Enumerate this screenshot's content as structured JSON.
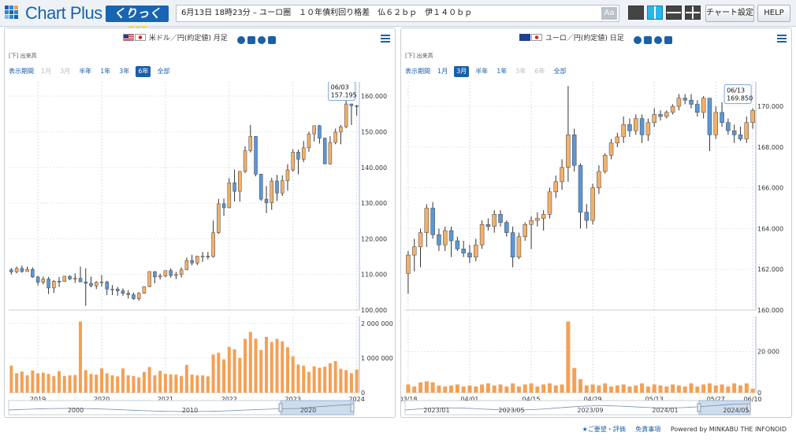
{
  "header": {
    "logo_text": "Chart Plus",
    "logo_badge_prefix": "くりっく",
    "logo_badge_number": "365",
    "ticker_text": "6月13日 18時23分 – ユーロ圏　１０年債利回り格差　仏６２ｂｐ　伊１４０ｂｐ",
    "font_button": "Aa",
    "chart_settings_label": "チャート設定",
    "help_label": "HELP",
    "layout_buttons": [
      "layout-1",
      "layout-2",
      "layout-3",
      "layout-4"
    ]
  },
  "colors": {
    "up": "#f2b06b",
    "down": "#5b97d6",
    "volume": "#f4a055",
    "accent": "#1a5fa8"
  },
  "panels": [
    {
      "title": "米ドル／円(約定値) 月足",
      "flags": [
        "us",
        "jp"
      ],
      "unit_label": "[下] 出来高",
      "period_label": "表示期間",
      "periods": [
        {
          "label": "1月",
          "state": "disabled"
        },
        {
          "label": "3月",
          "state": "disabled"
        },
        {
          "label": "半年",
          "state": "normal"
        },
        {
          "label": "1年",
          "state": "normal"
        },
        {
          "label": "3年",
          "state": "normal"
        },
        {
          "label": "6年",
          "state": "selected"
        },
        {
          "label": "全部",
          "state": "normal"
        }
      ],
      "tooltip_date": "06/03",
      "tooltip_value": "157.195",
      "navigator_labels": [
        "2000",
        "2010",
        "2020"
      ]
    },
    {
      "title": "ユーロ／円(約定値) 日足",
      "flags": [
        "eu",
        "jp"
      ],
      "unit_label": "[下] 出来高",
      "period_label": "表示期間",
      "periods": [
        {
          "label": "1月",
          "state": "normal"
        },
        {
          "label": "3月",
          "state": "selected"
        },
        {
          "label": "半年",
          "state": "normal"
        },
        {
          "label": "1年",
          "state": "normal"
        },
        {
          "label": "3年",
          "state": "disabled"
        },
        {
          "label": "6年",
          "state": "disabled"
        },
        {
          "label": "全部",
          "state": "normal"
        }
      ],
      "tooltip_date": "06/13",
      "tooltip_value": "169.850",
      "navigator_labels": [
        "2023/01",
        "2023/05",
        "2023/09",
        "2024/01",
        "2024/05"
      ]
    }
  ],
  "chart_data": [
    {
      "type": "candlestick",
      "title": "米ドル／円(約定値) 月足",
      "x_tick_labels": [
        "2019",
        "2020",
        "2021",
        "2022",
        "2023",
        "2024"
      ],
      "y_tick_labels": [
        "100.000",
        "110.000",
        "120.000",
        "130.000",
        "140.000",
        "150.000",
        "160.000"
      ],
      "ylim": [
        100,
        164
      ],
      "volume_tick_labels": [
        "0",
        "1 000 000",
        "2 000 000"
      ],
      "volume_ylim": [
        0,
        2200000
      ],
      "ohlc": [
        [
          111.3,
          111.8,
          110.0,
          110.7
        ],
        [
          110.7,
          112.2,
          110.3,
          111.7
        ],
        [
          111.7,
          112.5,
          110.5,
          110.8
        ],
        [
          110.8,
          112.2,
          110.8,
          111.4
        ],
        [
          111.4,
          112.0,
          109.0,
          109.3
        ],
        [
          109.3,
          109.6,
          106.9,
          107.8
        ],
        [
          107.8,
          109.4,
          107.2,
          108.7
        ],
        [
          108.7,
          109.3,
          104.5,
          106.2
        ],
        [
          106.2,
          108.4,
          104.8,
          108.1
        ],
        [
          108.1,
          109.3,
          106.5,
          108.0
        ],
        [
          108.0,
          109.6,
          107.9,
          109.5
        ],
        [
          109.5,
          109.7,
          108.4,
          108.7
        ],
        [
          108.7,
          110.3,
          107.6,
          108.9
        ],
        [
          108.9,
          112.2,
          107.9,
          107.9
        ],
        [
          107.9,
          111.7,
          101.2,
          107.5
        ],
        [
          107.5,
          109.4,
          106.4,
          106.8
        ],
        [
          106.8,
          108.1,
          105.9,
          107.8
        ],
        [
          107.8,
          109.8,
          106.6,
          107.9
        ],
        [
          107.9,
          108.2,
          104.2,
          105.9
        ],
        [
          105.9,
          107.0,
          104.2,
          105.9
        ],
        [
          105.9,
          106.5,
          104.0,
          105.4
        ],
        [
          105.4,
          106.1,
          104.0,
          104.7
        ],
        [
          104.7,
          105.6,
          103.2,
          104.3
        ],
        [
          104.3,
          104.9,
          102.9,
          103.2
        ],
        [
          103.2,
          105.0,
          102.6,
          104.7
        ],
        [
          104.7,
          106.6,
          104.6,
          106.6
        ],
        [
          106.6,
          110.9,
          106.4,
          110.8
        ],
        [
          110.8,
          110.9,
          107.5,
          109.3
        ],
        [
          109.3,
          110.2,
          108.6,
          109.6
        ],
        [
          109.6,
          111.1,
          109.2,
          111.1
        ],
        [
          111.1,
          111.7,
          109.1,
          109.7
        ],
        [
          109.7,
          110.7,
          108.7,
          110.0
        ],
        [
          110.0,
          112.0,
          109.1,
          111.3
        ],
        [
          111.3,
          114.7,
          111.2,
          113.9
        ],
        [
          113.9,
          115.5,
          112.5,
          113.2
        ],
        [
          113.2,
          115.2,
          112.6,
          115.1
        ],
        [
          115.1,
          116.3,
          113.5,
          115.1
        ],
        [
          115.1,
          116.3,
          114.2,
          115.0
        ],
        [
          115.0,
          125.1,
          114.7,
          121.7
        ],
        [
          121.7,
          131.2,
          121.3,
          129.8
        ],
        [
          129.8,
          131.3,
          126.4,
          128.7
        ],
        [
          128.7,
          137.0,
          128.6,
          135.7
        ],
        [
          135.7,
          139.4,
          130.4,
          133.3
        ],
        [
          133.3,
          139.0,
          130.4,
          138.9
        ],
        [
          138.9,
          145.9,
          138.4,
          144.7
        ],
        [
          144.7,
          151.9,
          144.2,
          148.7
        ],
        [
          148.7,
          148.8,
          137.5,
          138.1
        ],
        [
          138.1,
          138.2,
          130.6,
          131.1
        ],
        [
          131.1,
          134.8,
          127.2,
          130.1
        ],
        [
          130.1,
          137.1,
          128.1,
          136.2
        ],
        [
          136.2,
          137.9,
          130.6,
          132.8
        ],
        [
          132.8,
          137.8,
          132.0,
          136.3
        ],
        [
          136.3,
          140.9,
          133.5,
          139.3
        ],
        [
          139.3,
          145.1,
          138.8,
          144.3
        ],
        [
          144.3,
          145.0,
          138.1,
          142.3
        ],
        [
          142.3,
          147.4,
          141.5,
          145.5
        ],
        [
          145.5,
          150.0,
          144.4,
          149.4
        ],
        [
          149.4,
          151.7,
          147.3,
          151.7
        ],
        [
          151.7,
          151.9,
          146.7,
          148.2
        ],
        [
          148.2,
          148.4,
          140.9,
          141.0
        ],
        [
          141.0,
          148.8,
          140.8,
          147.0
        ],
        [
          147.0,
          150.9,
          146.5,
          149.9
        ],
        [
          149.9,
          151.9,
          146.5,
          151.4
        ],
        [
          151.4,
          160.2,
          151.0,
          157.8
        ],
        [
          157.8,
          157.9,
          151.9,
          157.3
        ],
        [
          157.3,
          157.5,
          154.5,
          157.2
        ]
      ],
      "volume": [
        780000,
        560000,
        610000,
        500000,
        640000,
        560000,
        580000,
        540000,
        480000,
        620000,
        480000,
        500000,
        510000,
        2050000,
        650000,
        540000,
        520000,
        700000,
        560000,
        500000,
        470000,
        700000,
        500000,
        480000,
        440000,
        600000,
        740000,
        500000,
        630000,
        540000,
        530000,
        520000,
        480000,
        800000,
        520000,
        500000,
        500000,
        470000,
        1100000,
        1150000,
        960000,
        1320000,
        1250000,
        1000000,
        1550000,
        1750000,
        1560000,
        1230000,
        1610000,
        1460000,
        1550000,
        1480000,
        1310000,
        1050000,
        810000,
        780000,
        600000,
        760000,
        720000,
        750000,
        850000,
        910000,
        690000,
        650000,
        560000,
        670000
      ]
    },
    {
      "type": "candlestick",
      "title": "ユーロ／円(約定値) 日足",
      "x_tick_labels": [
        "03/18",
        "04/01",
        "04/15",
        "04/29",
        "05/13",
        "05/27",
        "06/10"
      ],
      "y_tick_labels": [
        "160.000",
        "162.000",
        "164.000",
        "166.000",
        "168.000",
        "170.000"
      ],
      "ylim": [
        160,
        171.2
      ],
      "volume_tick_labels": [
        "0",
        "20 000"
      ],
      "volume_ylim": [
        0,
        37000
      ],
      "ohlc": [
        [
          161.8,
          162.9,
          160.8,
          162.7
        ],
        [
          162.7,
          163.5,
          161.9,
          163.1
        ],
        [
          163.1,
          164.0,
          162.1,
          163.8
        ],
        [
          163.8,
          165.2,
          163.1,
          165.0
        ],
        [
          165.0,
          165.3,
          163.5,
          163.7
        ],
        [
          163.7,
          164.0,
          162.9,
          163.2
        ],
        [
          163.2,
          164.1,
          162.9,
          163.9
        ],
        [
          163.9,
          164.1,
          162.6,
          163.4
        ],
        [
          163.4,
          163.6,
          162.9,
          163.0
        ],
        [
          163.0,
          163.4,
          162.6,
          162.8
        ],
        [
          162.8,
          163.2,
          162.3,
          162.6
        ],
        [
          162.6,
          163.5,
          162.4,
          163.2
        ],
        [
          163.2,
          164.4,
          163.0,
          164.2
        ],
        [
          164.2,
          164.5,
          163.9,
          164.1
        ],
        [
          164.1,
          164.9,
          163.8,
          164.7
        ],
        [
          164.7,
          164.9,
          164.1,
          164.3
        ],
        [
          164.3,
          164.4,
          163.6,
          163.8
        ],
        [
          163.8,
          164.1,
          162.1,
          162.6
        ],
        [
          162.6,
          163.8,
          162.5,
          163.6
        ],
        [
          163.6,
          164.3,
          163.4,
          164.2
        ],
        [
          164.2,
          164.6,
          163.0,
          164.4
        ],
        [
          164.4,
          164.8,
          164.1,
          164.5
        ],
        [
          164.5,
          164.9,
          163.9,
          164.7
        ],
        [
          164.7,
          166.0,
          164.5,
          165.8
        ],
        [
          165.8,
          166.6,
          165.5,
          166.3
        ],
        [
          166.3,
          167.4,
          165.9,
          167.0
        ],
        [
          167.0,
          171.0,
          166.3,
          168.6
        ],
        [
          168.6,
          168.9,
          166.8,
          167.1
        ],
        [
          167.1,
          167.2,
          164.0,
          164.8
        ],
        [
          164.8,
          165.2,
          164.0,
          164.4
        ],
        [
          164.4,
          166.2,
          164.2,
          166.0
        ],
        [
          166.0,
          167.1,
          165.7,
          166.8
        ],
        [
          166.8,
          167.7,
          166.7,
          167.6
        ],
        [
          167.6,
          168.4,
          167.4,
          168.2
        ],
        [
          168.2,
          168.7,
          168.0,
          168.5
        ],
        [
          168.5,
          169.5,
          168.2,
          169.1
        ],
        [
          169.1,
          169.4,
          168.5,
          168.8
        ],
        [
          168.8,
          169.6,
          168.6,
          169.4
        ],
        [
          169.4,
          169.6,
          168.2,
          168.6
        ],
        [
          168.6,
          169.4,
          168.3,
          169.2
        ],
        [
          169.2,
          169.9,
          169.0,
          169.6
        ],
        [
          169.6,
          169.8,
          169.3,
          169.5
        ],
        [
          169.5,
          169.8,
          169.4,
          169.7
        ],
        [
          169.7,
          170.1,
          169.6,
          170.0
        ],
        [
          170.0,
          170.6,
          169.8,
          170.4
        ],
        [
          170.4,
          170.6,
          170.1,
          170.3
        ],
        [
          170.3,
          170.6,
          169.9,
          170.1
        ],
        [
          170.1,
          170.3,
          169.5,
          169.7
        ],
        [
          169.7,
          170.5,
          169.4,
          170.4
        ],
        [
          170.4,
          170.4,
          167.8,
          168.6
        ],
        [
          168.6,
          170.0,
          168.4,
          169.7
        ],
        [
          169.7,
          170.2,
          169.0,
          169.2
        ],
        [
          169.2,
          169.4,
          168.6,
          168.8
        ],
        [
          168.8,
          169.1,
          168.2,
          168.6
        ],
        [
          168.6,
          169.0,
          168.3,
          168.4
        ],
        [
          168.4,
          169.5,
          168.2,
          169.2
        ],
        [
          169.2,
          169.9,
          168.9,
          169.8
        ]
      ],
      "volume": [
        4000,
        3000,
        5000,
        5500,
        5000,
        3500,
        3000,
        3500,
        4000,
        3000,
        3500,
        3000,
        4000,
        4500,
        3500,
        4000,
        3000,
        4500,
        3000,
        4000,
        4500,
        3000,
        4000,
        4500,
        3500,
        4000,
        34500,
        12000,
        6500,
        3500,
        4000,
        3500,
        4500,
        3000,
        3500,
        4000,
        3000,
        3500,
        4500,
        3000,
        4000,
        3500,
        3000,
        4000,
        3500,
        3000,
        4500,
        3000,
        4000,
        4500,
        3500,
        4000,
        3000,
        4500,
        3500,
        4500,
        2000
      ]
    }
  ]
}
